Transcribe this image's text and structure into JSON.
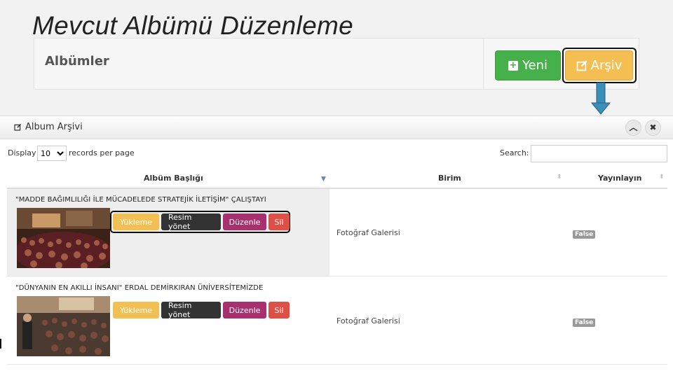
{
  "slide": {
    "title": "Mevcut Albümü Düzenleme"
  },
  "albums_panel": {
    "label": "Albümler",
    "new_button": "Yeni",
    "archive_button": "Arşiv"
  },
  "archive": {
    "title": "Album Arşivi",
    "display_label": "Display",
    "page_size": "10",
    "records_label": "records per page",
    "search_label": "Search:",
    "search_value": "",
    "columns": [
      "Albüm Başlığı",
      "Birim",
      "Yayınlayın"
    ],
    "rows": [
      {
        "title": "\"MADDE BAĞIMLILIĞI İLE MÜCADELEDE STRATEJİK İLETİŞİM\" ÇALIŞTAYI",
        "actions": [
          "Yükleme",
          "Resim yönet",
          "Düzenle",
          "Sil"
        ],
        "unit": "Fotoğraf Galerisi",
        "published": "False"
      },
      {
        "title": "\"DÜNYANIN EN AKILLI İNSANI\" ERDAL DEMİRKIRAN ÜNİVERSİTEMİZDE",
        "actions": [
          "Yükleme",
          "Resim yönet",
          "Düzenle",
          "Sil"
        ],
        "unit": "Fotoğraf Galerisi",
        "published": "False"
      }
    ]
  },
  "colors": {
    "green": "#46b04a",
    "yellow": "#f3be52",
    "dark": "#333333",
    "purple": "#a8306f",
    "red": "#de4f46",
    "arrow": "#3a8fb8"
  },
  "icons": [
    "plus-icon",
    "edit-icon",
    "chevron-up-icon",
    "close-icon",
    "sort-icon"
  ]
}
